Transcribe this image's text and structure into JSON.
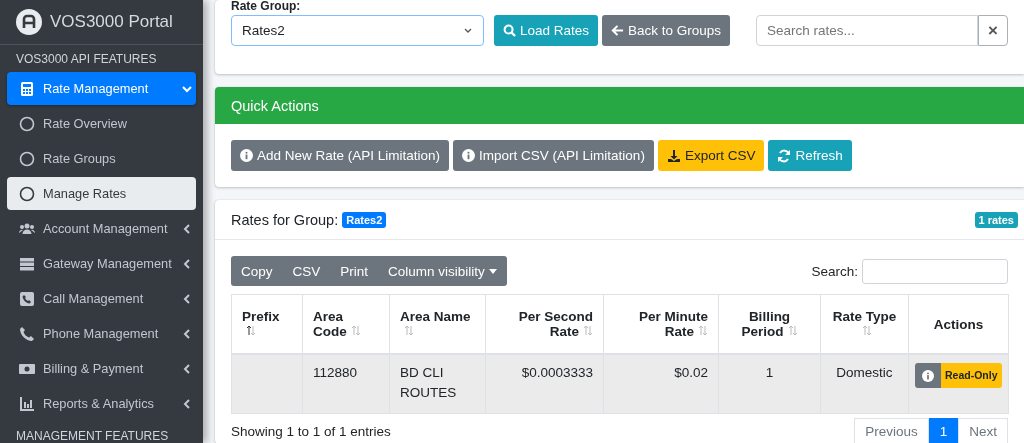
{
  "sidebar": {
    "brand": "VOS3000 Portal",
    "section_title": "VOS3000 API FEATURES",
    "items": [
      {
        "label": "Rate Management",
        "selected": true,
        "expanded": true,
        "children": [
          {
            "label": "Rate Overview",
            "selected": false
          },
          {
            "label": "Rate Groups",
            "selected": false
          },
          {
            "label": "Manage Rates",
            "selected": true
          }
        ]
      },
      {
        "label": "Account Management",
        "selected": false,
        "expanded": false
      },
      {
        "label": "Gateway Management",
        "selected": false,
        "expanded": false
      },
      {
        "label": "Call Management",
        "selected": false,
        "expanded": false
      },
      {
        "label": "Phone Management",
        "selected": false,
        "expanded": false
      },
      {
        "label": "Billing & Payment",
        "selected": false,
        "expanded": false
      },
      {
        "label": "Reports & Analytics",
        "selected": false,
        "expanded": false
      }
    ],
    "section_title_2": "MANAGEMENT FEATURES"
  },
  "rate_group_card": {
    "label": "Rate Group:",
    "select_value": "Rates2",
    "load_button": "Load Rates",
    "back_button": "Back to Groups",
    "search": {
      "placeholder": "Search rates..."
    },
    "clear_button": "×"
  },
  "quick_actions": {
    "title": "Quick Actions",
    "buttons": [
      {
        "label": "Add New Rate (API Limitation)",
        "kind": "info"
      },
      {
        "label": "Import CSV (API Limitation)",
        "kind": "info"
      },
      {
        "label": "Export CSV",
        "kind": "export"
      },
      {
        "label": "Refresh",
        "kind": "refresh"
      }
    ]
  },
  "rates_card": {
    "title": "Rates for Group:",
    "group_badge": "Rates2",
    "count_badge": "1 rates",
    "table_buttons": [
      "Copy",
      "CSV",
      "Print",
      "Column visibility"
    ],
    "search_label": "Search:",
    "table": {
      "columns": [
        {
          "label": "Prefix",
          "sorted": true
        },
        {
          "label": "Area Code",
          "sorted": false
        },
        {
          "label": "Area Name",
          "sorted": false
        },
        {
          "label": "Per Second Rate",
          "sorted": false
        },
        {
          "label": "Per Minute Rate",
          "sorted": false
        },
        {
          "label": "Billing Period",
          "sorted": false
        },
        {
          "label": "Rate Type",
          "sorted": false
        },
        {
          "label": "Actions"
        }
      ],
      "rows": [
        {
          "area_code": "112880",
          "area_name": "BD CLI ROUTES",
          "per_second_rate": "$0.0003333",
          "per_minute_rate": "$0.02",
          "billing_period": "1",
          "rate_type": "Domestic",
          "action_badge": "Read-Only"
        }
      ]
    },
    "info": "Showing 1 to 1 of 1 entries",
    "pagination": {
      "previous": {
        "label": "Previous",
        "disabled": true
      },
      "pages": [
        {
          "label": "1",
          "selected": true
        }
      ],
      "next": {
        "label": "Next",
        "disabled": true
      }
    }
  }
}
